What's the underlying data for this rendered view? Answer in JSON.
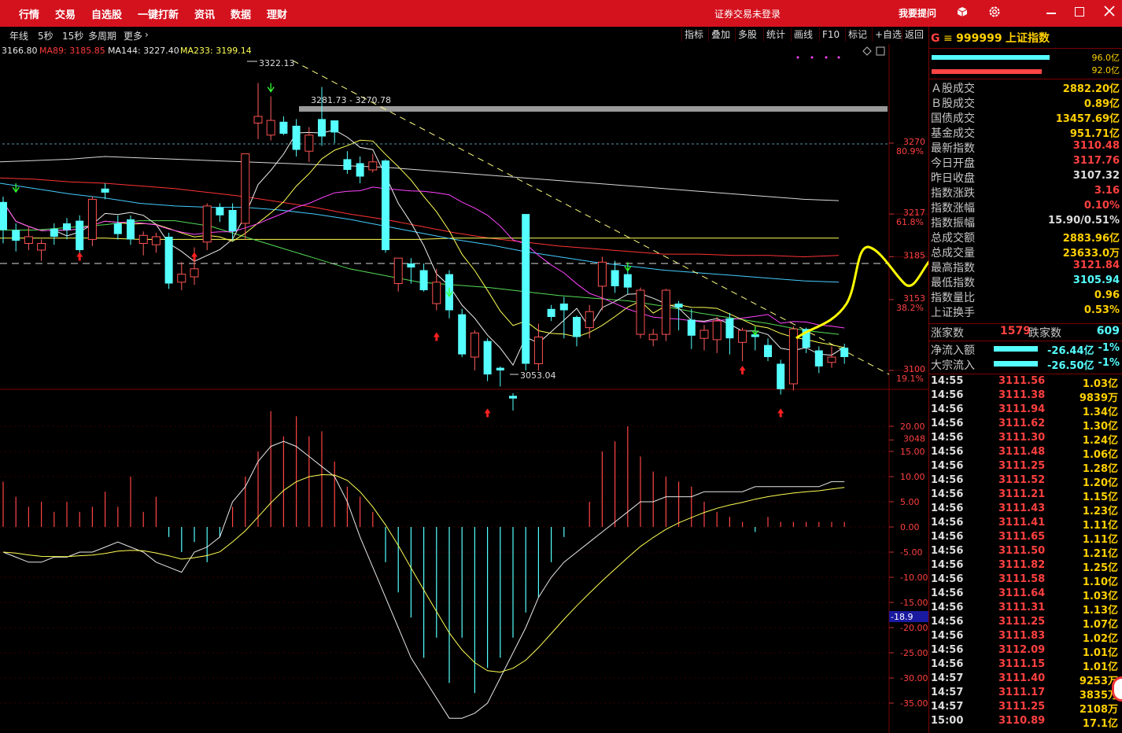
{
  "app": {
    "nav": [
      "行情",
      "交易",
      "自选股",
      "一键打新",
      "资讯",
      "数据",
      "理财"
    ],
    "status": "证券交易未登录",
    "ask": "我要提问"
  },
  "toolbar": {
    "periods": [
      "年线",
      "5秒",
      "15秒",
      "多周期",
      "更多"
    ],
    "tools": [
      "指标",
      "叠加",
      "多股",
      "统计",
      "画线",
      "F10",
      "标记",
      "+自选",
      "返回"
    ]
  },
  "ma_legend": [
    {
      "label": "3166.80",
      "color": "#e8e8e8"
    },
    {
      "label": "MA89: 3185.85",
      "color": "#ff3b3b"
    },
    {
      "label": "MA144: 3227.40",
      "color": "#e8e8e8"
    },
    {
      "label": "MA233: 3199.14",
      "color": "#ffff55"
    }
  ],
  "chart_annotations": {
    "high": "3322.13",
    "range": "3281.73 - 3270.78",
    "low": "3053.04"
  },
  "price_axis": [
    {
      "price": "3270",
      "pct": "80.9%"
    },
    {
      "price": "3217",
      "pct": "61.8%"
    },
    {
      "price": "3185",
      "pct": ""
    },
    {
      "price": "3153",
      "pct": "38.2%"
    },
    {
      "price": "3100",
      "pct": "19.1%"
    },
    {
      "price": "3048",
      "pct": ""
    }
  ],
  "macd_axis": [
    "20.00",
    "15.00",
    "10.00",
    "5.00",
    "0.00",
    "-5.00",
    "-10.00",
    "-15.00",
    "-20.00",
    "-25.00",
    "-30.00",
    "-35.00"
  ],
  "macd_current": "-18.9",
  "side": {
    "prefix": "G",
    "menu": "≡",
    "code": "999999",
    "name": "上证指数",
    "bar_pct": [
      "96.0亿",
      "92.0亿"
    ],
    "stats": [
      {
        "label": "Ａ股成交",
        "value": "2882.20亿",
        "color": "#ffd000"
      },
      {
        "label": "Ｂ股成交",
        "value": "0.89亿",
        "color": "#ffd000"
      },
      {
        "label": "国债成交",
        "value": "13457.69亿",
        "color": "#ffd000"
      },
      {
        "label": "基金成交",
        "value": "951.71亿",
        "color": "#ffd000"
      },
      {
        "label": "最新指数",
        "value": "3110.48",
        "color": "#ff4040"
      },
      {
        "label": "今日开盘",
        "value": "3117.76",
        "color": "#ff4040"
      },
      {
        "label": "昨日收盘",
        "value": "3107.32",
        "color": "#dddddd"
      },
      {
        "label": "指数涨跌",
        "value": "3.16",
        "color": "#ff4040"
      },
      {
        "label": "指数涨幅",
        "value": "0.10%",
        "color": "#ff4040"
      },
      {
        "label": "指数振幅",
        "value": "15.90/0.51%",
        "color": "#dddddd"
      },
      {
        "label": "总成交额",
        "value": "2883.96亿",
        "color": "#ffd000"
      },
      {
        "label": "总成交量",
        "value": "23633.0万",
        "color": "#ffd000"
      },
      {
        "label": "最高指数",
        "value": "3121.84",
        "color": "#ff4040"
      },
      {
        "label": "最低指数",
        "value": "3105.94",
        "color": "#55ffff"
      },
      {
        "label": "指数量比",
        "value": "0.96",
        "color": "#ffd000"
      },
      {
        "label": "上证换手",
        "value": "0.53%",
        "color": "#ffd000"
      }
    ],
    "rise_label": "涨家数",
    "rise": "1579",
    "fall_label": "跌家数",
    "fall": "609",
    "flows": [
      {
        "label": "净流入额",
        "value": "-26.44亿",
        "pct": "-1%"
      },
      {
        "label": "大宗流入",
        "value": "-26.50亿",
        "pct": "-1%"
      }
    ],
    "ticks": [
      {
        "t": "14:55",
        "p": "3111.56",
        "v": "1.03亿"
      },
      {
        "t": "14:56",
        "p": "3111.38",
        "v": "9839万"
      },
      {
        "t": "14:56",
        "p": "3111.94",
        "v": "1.34亿"
      },
      {
        "t": "14:56",
        "p": "3111.62",
        "v": "1.30亿"
      },
      {
        "t": "14:56",
        "p": "3111.30",
        "v": "1.24亿"
      },
      {
        "t": "14:56",
        "p": "3111.48",
        "v": "1.06亿"
      },
      {
        "t": "14:56",
        "p": "3111.25",
        "v": "1.28亿"
      },
      {
        "t": "14:56",
        "p": "3111.52",
        "v": "1.20亿"
      },
      {
        "t": "14:56",
        "p": "3111.21",
        "v": "1.15亿"
      },
      {
        "t": "14:56",
        "p": "3111.43",
        "v": "1.23亿"
      },
      {
        "t": "14:56",
        "p": "3111.41",
        "v": "1.11亿"
      },
      {
        "t": "14:56",
        "p": "3111.65",
        "v": "1.11亿"
      },
      {
        "t": "14:56",
        "p": "3111.50",
        "v": "1.21亿"
      },
      {
        "t": "14:56",
        "p": "3111.82",
        "v": "1.25亿"
      },
      {
        "t": "14:56",
        "p": "3111.58",
        "v": "1.10亿"
      },
      {
        "t": "14:56",
        "p": "3111.64",
        "v": "1.03亿"
      },
      {
        "t": "14:56",
        "p": "3111.31",
        "v": "1.13亿"
      },
      {
        "t": "14:56",
        "p": "3111.25",
        "v": "1.07亿"
      },
      {
        "t": "14:56",
        "p": "3111.83",
        "v": "1.02亿"
      },
      {
        "t": "14:56",
        "p": "3112.09",
        "v": "1.01亿"
      },
      {
        "t": "14:56",
        "p": "3111.15",
        "v": "1.01亿"
      },
      {
        "t": "14:57",
        "p": "3111.40",
        "v": "9253万"
      },
      {
        "t": "14:57",
        "p": "3111.17",
        "v": "3835万"
      },
      {
        "t": "14:57",
        "p": "3111.25",
        "v": "2108万"
      },
      {
        "t": "15:00",
        "p": "3110.89",
        "v": "17.1亿"
      }
    ]
  },
  "candles": [
    [
      3205,
      3226,
      3195,
      3230,
      "d"
    ],
    [
      3205,
      3197,
      3189,
      3210,
      "d"
    ],
    [
      3195,
      3200,
      3190,
      3207,
      "u"
    ],
    [
      3190,
      3195,
      3182,
      3198,
      "u"
    ],
    [
      3200,
      3206,
      3194,
      3210,
      "d"
    ],
    [
      3210,
      3205,
      3198,
      3214,
      "d"
    ],
    [
      3190,
      3212,
      3185,
      3216,
      "d"
    ],
    [
      3198,
      3228,
      3193,
      3230,
      "u"
    ],
    [
      3233,
      3236,
      3228,
      3240,
      "d"
    ],
    [
      3210,
      3202,
      3198,
      3216,
      "d"
    ],
    [
      3198,
      3213,
      3194,
      3216,
      "d"
    ],
    [
      3195,
      3201,
      3186,
      3204,
      "u"
    ],
    [
      3200,
      3194,
      3188,
      3203,
      "u"
    ],
    [
      3200,
      3165,
      3161,
      3203,
      "d"
    ],
    [
      3166,
      3172,
      3160,
      3181,
      "u"
    ],
    [
      3170,
      3176,
      3164,
      3192,
      "u"
    ],
    [
      3196,
      3223,
      3190,
      3225,
      "u"
    ],
    [
      3222,
      3216,
      3211,
      3225,
      "d"
    ],
    [
      3220,
      3204,
      3197,
      3225,
      "d"
    ],
    [
      3210,
      3262,
      3198,
      3262,
      "u"
    ],
    [
      3285,
      3290,
      3273,
      3315,
      "u"
    ],
    [
      3287,
      3276,
      3272,
      3305,
      "u"
    ],
    [
      3286,
      3277,
      3276,
      3290,
      "d"
    ],
    [
      3265,
      3283,
      3260,
      3288,
      "d"
    ],
    [
      3276,
      3264,
      3256,
      3282,
      "u"
    ],
    [
      3275,
      3288,
      3268,
      3312,
      "d"
    ],
    [
      3278,
      3287,
      3270,
      3282,
      "d"
    ],
    [
      3258,
      3250,
      3247,
      3264,
      "d"
    ],
    [
      3255,
      3245,
      3240,
      3260,
      "d"
    ],
    [
      3250,
      3256,
      3248,
      3262,
      "u"
    ],
    [
      3257,
      3190,
      3188,
      3258,
      "d"
    ],
    [
      3165,
      3184,
      3159,
      3184,
      "u"
    ],
    [
      3180,
      3177,
      3165,
      3184,
      "d"
    ],
    [
      3175,
      3160,
      3159,
      3180,
      "d"
    ],
    [
      3166,
      3150,
      3145,
      3176,
      "u"
    ],
    [
      3172,
      3145,
      3139,
      3175,
      "d"
    ],
    [
      3142,
      3112,
      3110,
      3146,
      "d"
    ],
    [
      3110,
      3128,
      3100,
      3130,
      "u"
    ],
    [
      3122,
      3097,
      3092,
      3124,
      "d"
    ],
    [
      3100,
      3102,
      3088,
      3103,
      "d"
    ],
    [
      3079,
      3081,
      3070,
      3083,
      "d"
    ],
    [
      3105,
      3217,
      3100,
      3217,
      "d"
    ],
    [
      3125,
      3105,
      3100,
      3135,
      "u"
    ],
    [
      3146,
      3140,
      3137,
      3149,
      "d"
    ],
    [
      3150,
      3145,
      3124,
      3155,
      "d"
    ],
    [
      3140,
      3125,
      3118,
      3141,
      "d"
    ],
    [
      3132,
      3144,
      3124,
      3149,
      "u"
    ],
    [
      3163,
      3181,
      3145,
      3185,
      "u"
    ],
    [
      3175,
      3163,
      3158,
      3182,
      "d"
    ],
    [
      3162,
      3172,
      3157,
      3176,
      "d"
    ],
    [
      3160,
      3127,
      3124,
      3162,
      "u"
    ],
    [
      3123,
      3127,
      3118,
      3131,
      "u"
    ],
    [
      3127,
      3160,
      3122,
      3161,
      "u"
    ],
    [
      3150,
      3147,
      3130,
      3152,
      "d"
    ],
    [
      3138,
      3126,
      3116,
      3146,
      "d"
    ],
    [
      3130,
      3124,
      3115,
      3134,
      "u"
    ],
    [
      3123,
      3137,
      3113,
      3140,
      "u"
    ],
    [
      3124,
      3139,
      3112,
      3143,
      "d"
    ],
    [
      3130,
      3121,
      3107,
      3132,
      "u"
    ],
    [
      3125,
      3127,
      3115,
      3131,
      "d"
    ],
    [
      3119,
      3110,
      3107,
      3124,
      "d"
    ],
    [
      3105,
      3086,
      3082,
      3108,
      "d"
    ],
    [
      3090,
      3131,
      3085,
      3133,
      "u"
    ],
    [
      3117,
      3131,
      3113,
      3132,
      "d"
    ],
    [
      3115,
      3103,
      3098,
      3118,
      "d"
    ],
    [
      3110,
      3106,
      3102,
      3118,
      "u"
    ],
    [
      3110,
      3117,
      3105,
      3120,
      "d"
    ]
  ],
  "ma_slow": {
    "white_long": [
      3256,
      3257,
      3258,
      3260,
      3259,
      3258,
      3257,
      3256,
      3255,
      3254,
      3253,
      3252,
      3250,
      3248,
      3246,
      3244,
      3242,
      3240,
      3238,
      3236,
      3234,
      3232,
      3230,
      3228,
      3227
    ],
    "red89": [
      3244,
      3243,
      3241,
      3240,
      3238,
      3236,
      3233,
      3230,
      3226,
      3222,
      3217,
      3213,
      3208,
      3203,
      3199,
      3196,
      3193,
      3191,
      3189,
      3187,
      3187,
      3186,
      3186,
      3185,
      3186
    ],
    "yellow233": [
      3199,
      3199,
      3199,
      3199,
      3198,
      3198,
      3198,
      3198,
      3198,
      3198,
      3198,
      3198,
      3198,
      3199,
      3199,
      3199,
      3199,
      3199,
      3199,
      3199,
      3199,
      3199,
      3199,
      3199,
      3199
    ],
    "cyan": [
      3240,
      3236,
      3232,
      3229,
      3225,
      3223,
      3222,
      3222,
      3220,
      3217,
      3213,
      3208,
      3203,
      3198,
      3194,
      3189,
      3185,
      3181,
      3178,
      3175,
      3173,
      3171,
      3169,
      3167,
      3166
    ],
    "green": [
      3205,
      3205,
      3207,
      3209,
      3212,
      3212,
      3208,
      3200,
      3192,
      3184,
      3176,
      3171,
      3166,
      3164,
      3162,
      3159,
      3156,
      3154,
      3152,
      3148,
      3143,
      3139,
      3135,
      3130,
      3127
    ]
  },
  "macd_hist": [
    9,
    6,
    4,
    5,
    3,
    5,
    3,
    4,
    7,
    4,
    10,
    3,
    6,
    -2,
    -5,
    -3,
    -7,
    -2,
    4,
    10,
    15,
    23,
    18,
    22,
    18,
    19,
    13,
    8,
    6,
    3,
    -7,
    -13,
    -18,
    -26,
    -22,
    -31,
    -22,
    -33,
    -28,
    -26,
    -22,
    -17,
    -14,
    -7,
    -2,
    0,
    5,
    15,
    17,
    20,
    14,
    11,
    10,
    9,
    8,
    5,
    3,
    2,
    1,
    -1,
    2,
    1,
    1,
    1,
    1,
    1,
    1
  ],
  "macd_dif": [
    -5,
    -6,
    -7,
    -7,
    -6,
    -6,
    -5,
    -5,
    -4,
    -3,
    -4,
    -5,
    -7,
    -8,
    -9,
    -5,
    -4,
    -2,
    5,
    8,
    13,
    16,
    17,
    16,
    14,
    12,
    10,
    5,
    -2,
    -8,
    -14,
    -20,
    -26,
    -30,
    -34,
    -38,
    -38,
    -37,
    -35,
    -30,
    -25,
    -20,
    -14,
    -10,
    -7,
    -5,
    -3,
    -1,
    1,
    3,
    5,
    5,
    6,
    6,
    6,
    7,
    7,
    7,
    7,
    8,
    8,
    8,
    8,
    8,
    8,
    9,
    9
  ]
}
